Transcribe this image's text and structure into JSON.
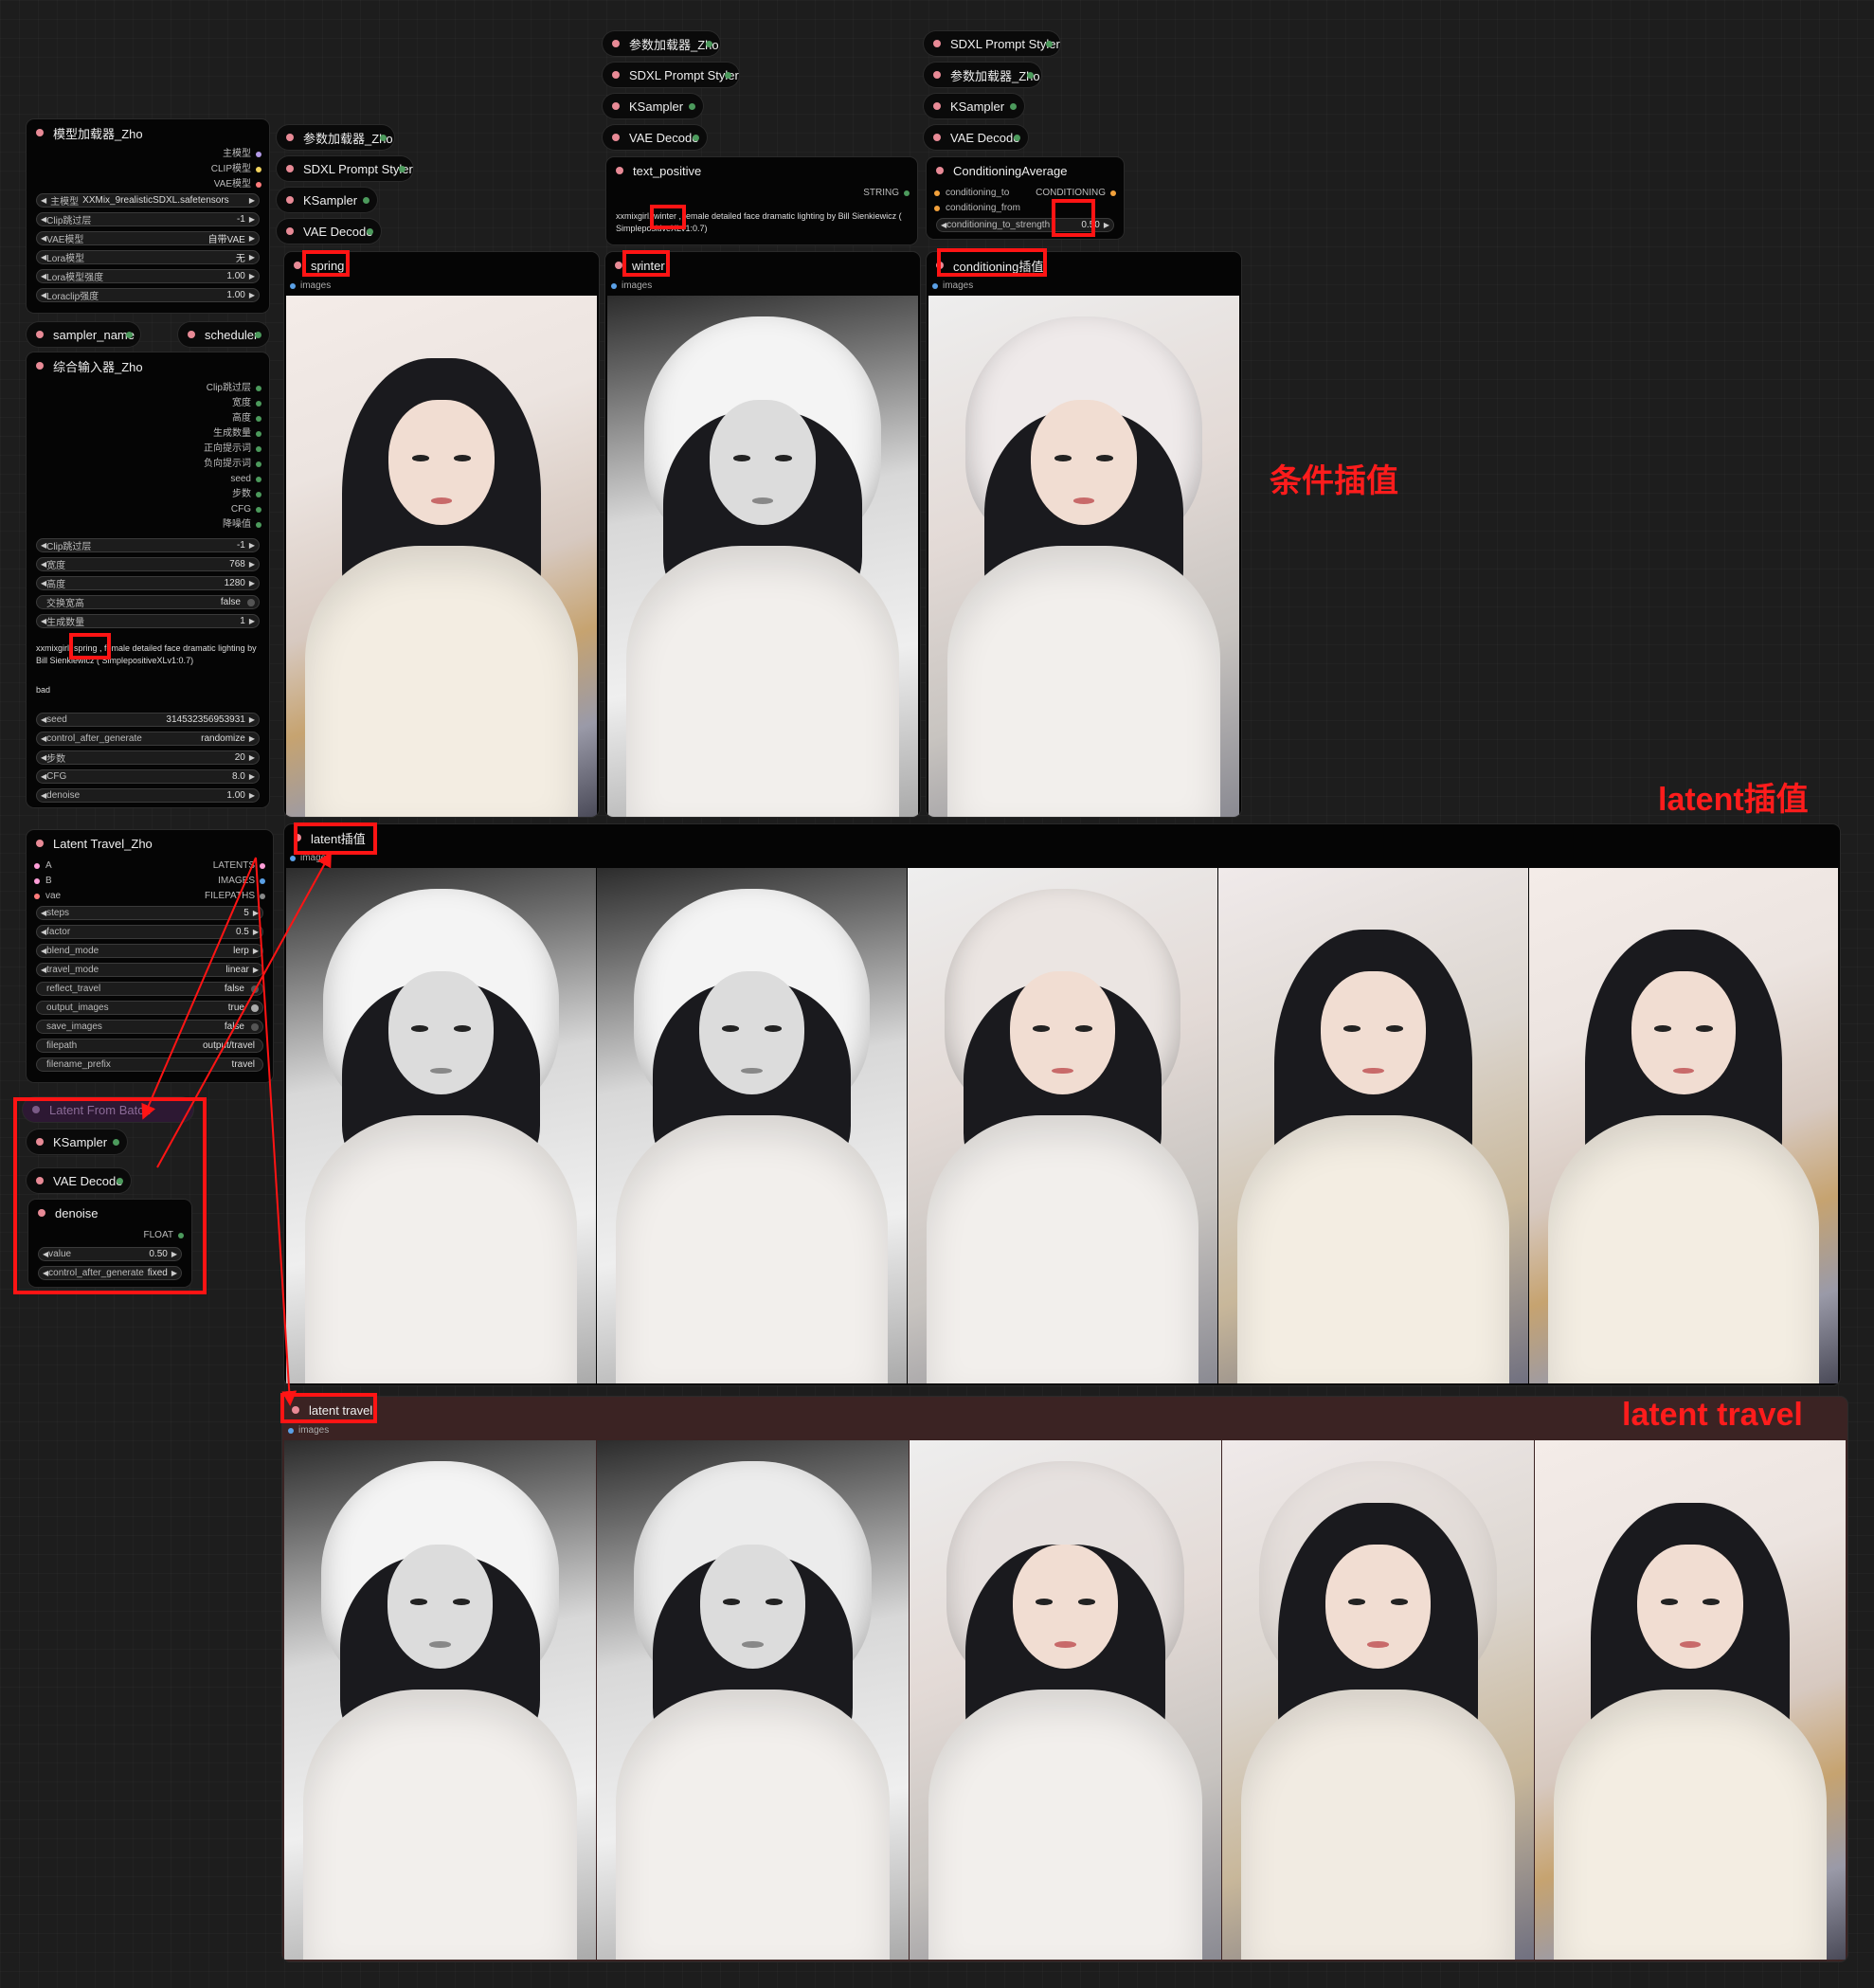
{
  "model_loader": {
    "title": "模型加载器_Zho",
    "outputs": [
      "主模型",
      "CLIP模型",
      "VAE模型"
    ],
    "widgets": [
      {
        "label": "主模型",
        "value": "XXMix_9realisticSDXL.safetensors"
      },
      {
        "label": "Clip跳过层",
        "value": "-1"
      },
      {
        "label": "VAE模型",
        "value": "自带VAE"
      },
      {
        "label": "Lora模型",
        "value": "无"
      },
      {
        "label": "Lora模型强度",
        "value": "1.00"
      },
      {
        "label": "Loraclip强度",
        "value": "1.00"
      }
    ]
  },
  "sampler_name": {
    "title": "sampler_name"
  },
  "scheduler": {
    "title": "scheduler"
  },
  "combo_input": {
    "title": "综合输入器_Zho",
    "outputs": [
      "Clip跳过层",
      "宽度",
      "高度",
      "生成数量",
      "正向提示词",
      "负向提示词",
      "seed",
      "步数",
      "CFG",
      "降噪值"
    ],
    "widgets": [
      {
        "label": "Clip跳过层",
        "value": "-1"
      },
      {
        "label": "宽度",
        "value": "768"
      },
      {
        "label": "高度",
        "value": "1280"
      },
      {
        "label": "交换宽高",
        "value": "false"
      },
      {
        "label": "生成数量",
        "value": "1"
      }
    ],
    "positive_prompt": "xxmixgirl, spring , female detailed face dramatic lighting by Bill Sienkiewicz ( SimplepositiveXLv1:0.7)",
    "negative_prompt": "bad",
    "widgets2": [
      {
        "label": "seed",
        "value": "314532356953931"
      },
      {
        "label": "control_after_generate",
        "value": "randomize"
      },
      {
        "label": "步数",
        "value": "20"
      },
      {
        "label": "CFG",
        "value": "8.0"
      },
      {
        "label": "denoise",
        "value": "1.00"
      }
    ]
  },
  "col1": {
    "param_loader": "参数加载器_Zho",
    "styler": "SDXL Prompt Styler",
    "ksampler": "KSampler",
    "vae_decode": "VAE Decode",
    "preview_title": "spring",
    "images_label": "images"
  },
  "col2": {
    "param_loader": "参数加载器_Zho",
    "styler": "SDXL Prompt Styler",
    "ksampler": "KSampler",
    "vae_decode": "VAE Decode",
    "text_title": "text_positive",
    "text_output": "STRING",
    "text_value": "xxmixgirl, winter , female detailed face dramatic lighting by Bill Sienkiewicz ( SimplepositiveXLv1:0.7)",
    "preview_title": "winter",
    "images_label": "images"
  },
  "col3": {
    "styler": "SDXL Prompt Styler",
    "param_loader": "参数加载器_Zho",
    "ksampler": "KSampler",
    "vae_decode": "VAE Decode",
    "cond_title": "ConditioningAverage",
    "cond_in1": "conditioning_to",
    "cond_in2": "conditioning_from",
    "cond_out": "CONDITIONING",
    "cond_widget_label": "conditioning_to_strength",
    "cond_widget_value": "0.50",
    "preview_title": "conditioning插值",
    "images_label": "images"
  },
  "latent_travel_node": {
    "title": "Latent Travel_Zho",
    "inputs": [
      "A",
      "B",
      "vae"
    ],
    "outputs": [
      "LATENTS",
      "IMAGES",
      "FILEPATHS"
    ],
    "widgets": [
      {
        "label": "steps",
        "value": "5"
      },
      {
        "label": "factor",
        "value": "0.5"
      },
      {
        "label": "blend_mode",
        "value": "lerp"
      },
      {
        "label": "travel_mode",
        "value": "linear"
      },
      {
        "label": "reflect_travel",
        "value": "false"
      },
      {
        "label": "output_images",
        "value": "true"
      },
      {
        "label": "save_images",
        "value": "false"
      },
      {
        "label": "filepath",
        "value": "output/travel"
      },
      {
        "label": "filename_prefix",
        "value": "travel"
      }
    ]
  },
  "group": {
    "latent_from_batch": "Latent From Batch",
    "ksampler": "KSampler",
    "vae_decode": "VAE Decode",
    "denoise_title": "denoise",
    "denoise_output": "FLOAT",
    "value_label": "value",
    "value": "0.50",
    "control_label": "control_after_generate",
    "control_value": "fixed"
  },
  "latent_interp_preview": {
    "title": "latent插值",
    "images_label": "images"
  },
  "latent_travel_preview": {
    "title": "latent travel",
    "images_label": "images"
  },
  "annotations": {
    "cond_interp": "条件插值",
    "latent_interp": "latent插值",
    "latent_travel": "latent travel"
  },
  "colors": {
    "annotation_red": "#ff1414",
    "node_bg": "#050505",
    "canvas_bg": "#1d1d1d"
  }
}
